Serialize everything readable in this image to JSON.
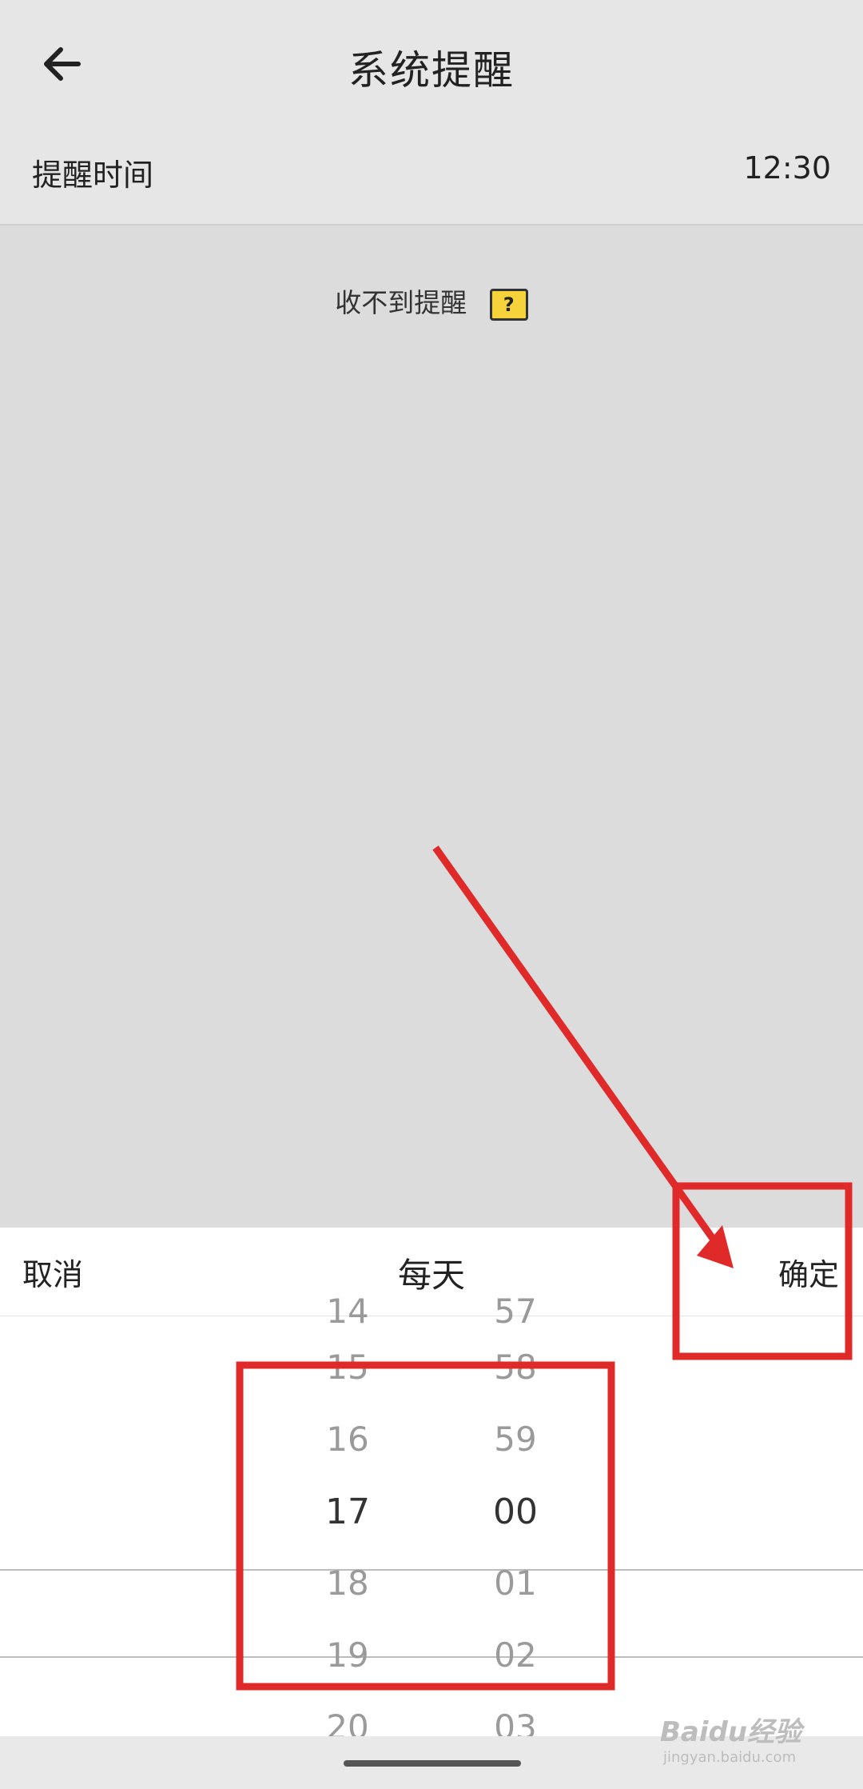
{
  "header": {
    "title": "系统提醒",
    "back_icon": "arrow-left-icon"
  },
  "reminder": {
    "label": "提醒时间",
    "value": "12:30"
  },
  "help": {
    "text": "收不到提醒",
    "icon": "help-bubble-icon",
    "icon_glyph": "?"
  },
  "sheet": {
    "cancel_label": "取消",
    "repeat_label": "每天",
    "confirm_label": "确定"
  },
  "picker": {
    "hours": [
      "14",
      "15",
      "16",
      "17",
      "18",
      "19",
      "20"
    ],
    "minutes": [
      "57",
      "58",
      "59",
      "00",
      "01",
      "02",
      "03"
    ],
    "selected_hour": "17",
    "selected_minute": "00"
  },
  "watermark": {
    "text": "Baidu经验",
    "sub": "jingyan.baidu.com"
  },
  "colors": {
    "annotation_red": "#e02a2a",
    "help_icon_yellow": "#f6d33b"
  }
}
